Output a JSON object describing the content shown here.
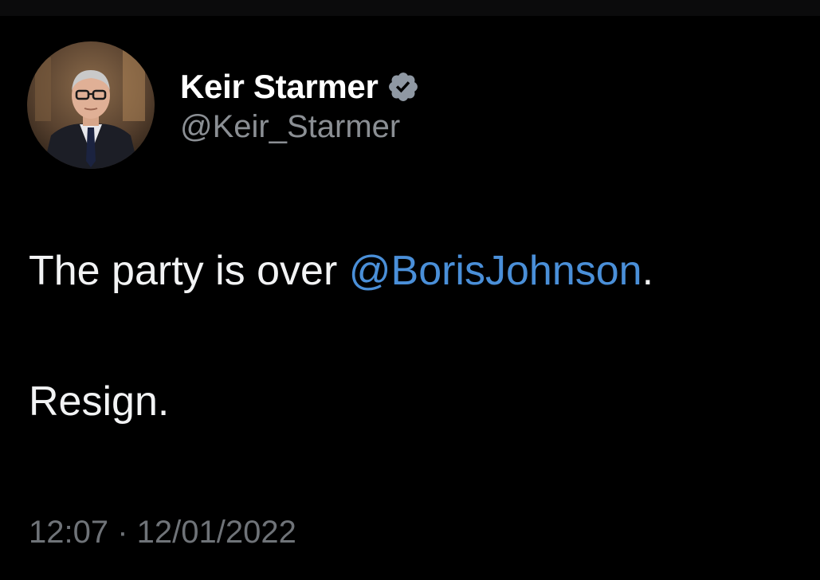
{
  "author": {
    "display_name": "Keir Starmer",
    "handle": "@Keir_Starmer",
    "verified_icon": "verified-badge-icon",
    "avatar": "profile-photo"
  },
  "tweet": {
    "line1_text": "The party is over ",
    "mention": "@BorisJohnson",
    "line1_end": ".",
    "line2": "Resign."
  },
  "meta": {
    "time": "12:07",
    "separator": " · ",
    "date": "12/01/2022"
  },
  "colors": {
    "background": "#000000",
    "mention": "#4a8fd8",
    "secondary_text": "#8b8f94",
    "verified_badge": "#8f98a3"
  }
}
